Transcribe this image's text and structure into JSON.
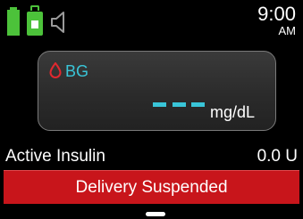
{
  "status": {
    "icons": [
      "battery-icon",
      "cartridge-icon",
      "speaker-icon"
    ],
    "time": "9:00",
    "ampm": "AM"
  },
  "bg": {
    "label": "BG",
    "value": "---",
    "unit": "mg/dL",
    "icon": "blood-drop-icon"
  },
  "active_insulin": {
    "label": "Active Insulin",
    "value": "0.0 U"
  },
  "delivery": {
    "status": "Delivery Suspended"
  },
  "colors": {
    "accent_green": "#4cc23a",
    "bg_cyan": "#39c5d8",
    "alert_red": "#c8151b",
    "drop_red": "#e0282f"
  }
}
